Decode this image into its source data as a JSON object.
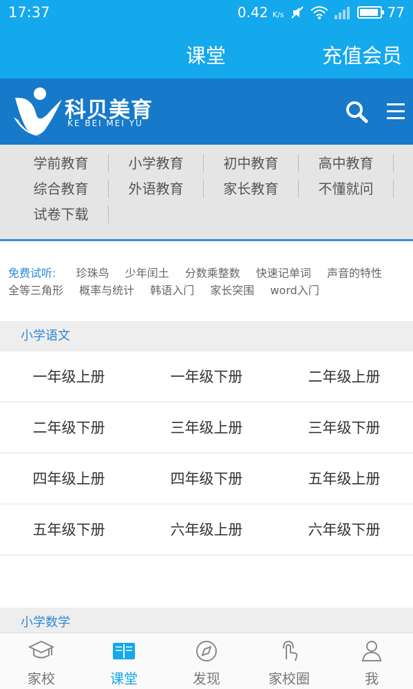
{
  "status_bar": {
    "time": "17:37",
    "speed": "0.42",
    "speed_unit": "K/s",
    "battery": "77"
  },
  "header": {
    "title": "课堂",
    "recharge": "充值会员"
  },
  "brand": {
    "name": "科贝美育",
    "subtitle": "KE BEI MEI YU"
  },
  "categories": [
    [
      "学前教育",
      "小学教育",
      "初中教育",
      "高中教育"
    ],
    [
      "综合教育",
      "外语教育",
      "家长教育",
      "不懂就问"
    ],
    [
      "试卷下载"
    ]
  ],
  "trial": {
    "label": "免费试听:",
    "items": [
      "珍珠鸟",
      "少年闰土",
      "分数乘整数",
      "快速记单词",
      "声音的特性",
      "全等三角形",
      "概率与统计",
      "韩语入门",
      "家长突围",
      "word入门"
    ]
  },
  "sections": {
    "chinese": "小学语文",
    "math": "小学数学"
  },
  "grades": [
    [
      "一年级上册",
      "一年级下册",
      "二年级上册"
    ],
    [
      "二年级下册",
      "三年级上册",
      "三年级下册"
    ],
    [
      "四年级上册",
      "四年级下册",
      "五年级上册"
    ],
    [
      "五年级下册",
      "六年级上册",
      "六年级下册"
    ]
  ],
  "tabs": [
    {
      "label": "家校",
      "icon": "graduation-cap-icon"
    },
    {
      "label": "课堂",
      "icon": "book-icon"
    },
    {
      "label": "发现",
      "icon": "compass-icon"
    },
    {
      "label": "家校圈",
      "icon": "touch-icon"
    },
    {
      "label": "我",
      "icon": "person-icon"
    }
  ],
  "colors": {
    "primary": "#14a8ec",
    "brand": "#1679c9",
    "link": "#2a88d8"
  }
}
